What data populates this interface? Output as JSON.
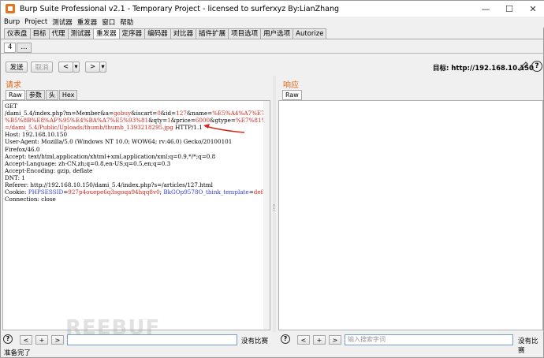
{
  "window": {
    "title": "Burp Suite Professional v2.1 - Temporary Project - licensed to surferxyz By:LianZhang",
    "minimize": "—",
    "maximize": "☐",
    "close": "✕"
  },
  "menu": [
    "Burp",
    "Project",
    "测试器",
    "重发器",
    "窗口",
    "帮助"
  ],
  "main_tabs": [
    "仪表盘",
    "目标",
    "代理",
    "测试器",
    "重发器",
    "定序器",
    "编码器",
    "对比器",
    "插件扩展",
    "项目选项",
    "用户选项",
    "Autorize"
  ],
  "main_tab_active": 4,
  "sub_tabs": [
    "4",
    "..."
  ],
  "toolbar": {
    "send": "发送",
    "cancel": "取消",
    "back": "<",
    "back_drop": "▾",
    "forward": ">",
    "forward_drop": "▾",
    "target_label": "目标: http://192.168.10.150",
    "help": "?"
  },
  "request": {
    "title": "请求",
    "tabs": [
      "Raw",
      "参数",
      "头",
      "Hex"
    ],
    "lines": [
      "GET",
      "/dami_5.4/index.php?m=Member&a=gobuy&iscart=0&id=127&name=%E5%A4%A7%E7%B1%B3%E6",
      "%B5%8B%E8%AF%95%E4%BA%A7%E5%93%81&qty=1&price=6000&gtype=%E7%81%B0%E8%89%B2&pic",
      "=/dami_5.4/Public/Uploads/thumb/thumb_1393218295.jpg HTTP/1.1",
      "Host: 192.168.10.150",
      "User-Agent: Mozilla/5.0 (Windows NT 10.0; WOW64; rv:46.0) Gecko/20100101",
      "Firefox/46.0",
      "Accept: text/html,application/xhtml+xml,application/xml;q=0.9,*/*;q=0.8",
      "Accept-Language: zh-CN,zh;q=0.8,en-US;q=0.5,en;q=0.3",
      "Accept-Encoding: gzip, deflate",
      "DNT: 1",
      "Referer: http://192.168.10.150/dami_5.4/index.php?s=/articles/127.html",
      "Cookie: PHPSESSID=927p4ouepe6q3sgoqa94hqq8v0; BkGOp9578O_think_template=default",
      "Connection: close"
    ]
  },
  "response": {
    "title": "响应",
    "tabs": [
      "Raw"
    ]
  },
  "search": {
    "help": "?",
    "prev": "<",
    "add": "+",
    "next": ">",
    "left_value": "",
    "right_placeholder": "输入搜索字词",
    "no_match": "没有比赛"
  },
  "status": "准备完了",
  "watermark": "REEBUF"
}
